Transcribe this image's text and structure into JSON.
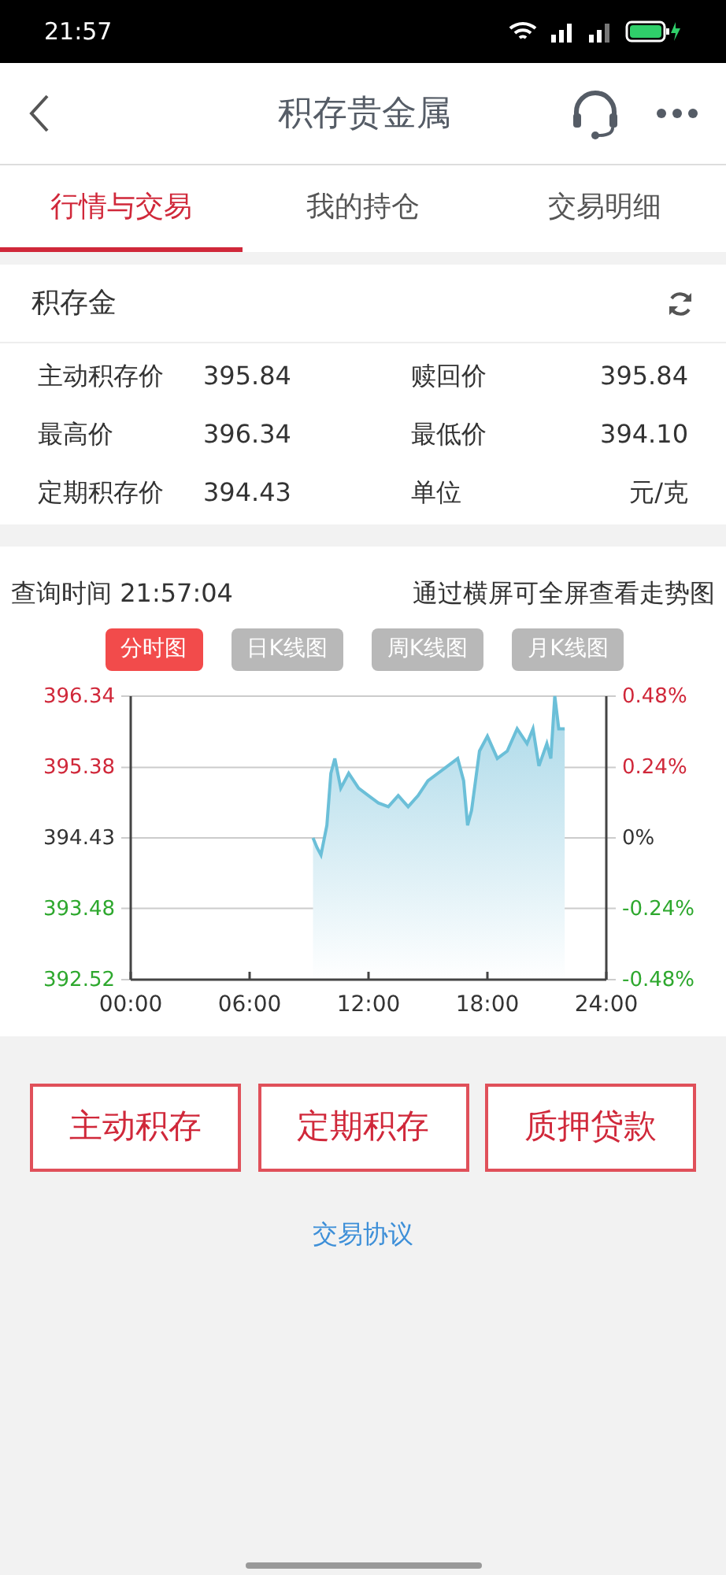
{
  "status_bar": {
    "time": "21:57"
  },
  "header": {
    "title": "积存贵金属"
  },
  "tabs": [
    {
      "label": "行情与交易",
      "selected": true
    },
    {
      "label": "我的持仓",
      "selected": false
    },
    {
      "label": "交易明细",
      "selected": false
    }
  ],
  "quote_card": {
    "title": "积存金",
    "rows": [
      [
        {
          "label": "主动积存价",
          "value": "395.84"
        },
        {
          "label": "赎回价",
          "value": "395.84"
        }
      ],
      [
        {
          "label": "最高价",
          "value": "396.34"
        },
        {
          "label": "最低价",
          "value": "394.10"
        }
      ],
      [
        {
          "label": "定期积存价",
          "value": "394.43"
        },
        {
          "label": "单位",
          "value": "元/克"
        }
      ]
    ]
  },
  "chart_panel": {
    "query_time": "查询时间 21:57:04",
    "hint": "通过横屏可全屏查看走势图",
    "chart_tabs": [
      {
        "label": "分时图",
        "selected": true
      },
      {
        "label": "日K线图",
        "selected": false
      },
      {
        "label": "周K线图",
        "selected": false
      },
      {
        "label": "月K线图",
        "selected": false
      }
    ],
    "percent_labels": [
      "0.48%",
      "0.24%",
      "0%",
      "-0.24%",
      "-0.48%"
    ],
    "chart_data": {
      "type": "area",
      "x": [
        9.2,
        9.4,
        9.6,
        9.9,
        10.1,
        10.3,
        10.6,
        11,
        11.5,
        12,
        12.5,
        13,
        13.5,
        14,
        14.5,
        15,
        15.5,
        16,
        16.5,
        16.8,
        17,
        17.2,
        17.6,
        18,
        18.5,
        19,
        19.5,
        20,
        20.3,
        20.6,
        21,
        21.2,
        21.4,
        21.6,
        21.9
      ],
      "grid": true,
      "series": [
        {
          "color": "#6bbfd8",
          "values": [
            394.43,
            394.3,
            394.2,
            394.6,
            395.3,
            395.5,
            395.1,
            395.3,
            395.1,
            395.0,
            394.9,
            394.85,
            395.0,
            394.85,
            395.0,
            395.2,
            395.3,
            395.4,
            395.5,
            395.2,
            394.6,
            394.8,
            395.6,
            395.8,
            395.5,
            395.6,
            395.9,
            395.7,
            395.9,
            395.4,
            395.7,
            395.5,
            396.34,
            395.9,
            395.9
          ]
        }
      ],
      "xlim": [
        0,
        24
      ],
      "ylim": [
        392.52,
        396.34
      ],
      "xticks": [
        {
          "value": 0,
          "label": "00:00"
        },
        {
          "value": 6,
          "label": "06:00"
        },
        {
          "value": 12,
          "label": "12:00"
        },
        {
          "value": 18,
          "label": "18:00"
        },
        {
          "value": 24,
          "label": "24:00"
        }
      ],
      "yticks": [
        {
          "value": 396.34,
          "label": "396.34"
        },
        {
          "value": 395.38,
          "label": "395.38"
        },
        {
          "value": 394.43,
          "label": "394.43"
        },
        {
          "value": 393.48,
          "label": "393.48"
        },
        {
          "value": 392.52,
          "label": "392.52"
        }
      ]
    }
  },
  "actions": [
    "主动积存",
    "定期积存",
    "质押贷款"
  ],
  "agreement_link": "交易协议"
}
